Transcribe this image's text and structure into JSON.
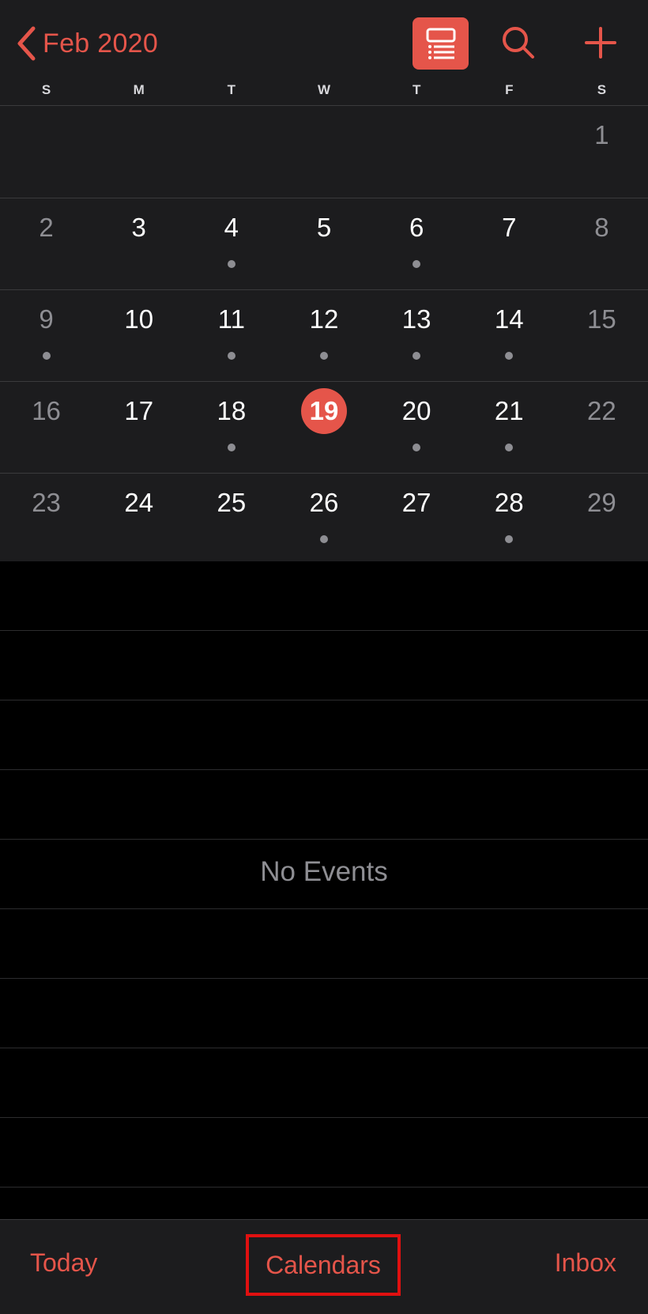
{
  "header": {
    "back_label": "Feb 2020",
    "accent_color": "#e5554a",
    "icons": {
      "back": "chevron-left-icon",
      "list_view": "list-view-icon",
      "search": "search-icon",
      "add": "plus-icon"
    }
  },
  "weekdays": [
    "S",
    "M",
    "T",
    "W",
    "T",
    "F",
    "S"
  ],
  "month": {
    "today": "19",
    "weeks": [
      [
        {
          "day": ""
        },
        {
          "day": ""
        },
        {
          "day": ""
        },
        {
          "day": ""
        },
        {
          "day": ""
        },
        {
          "day": ""
        },
        {
          "day": "1",
          "weekend": true
        }
      ],
      [
        {
          "day": "2",
          "weekend": true
        },
        {
          "day": "3"
        },
        {
          "day": "4",
          "event": true
        },
        {
          "day": "5"
        },
        {
          "day": "6",
          "event": true
        },
        {
          "day": "7"
        },
        {
          "day": "8",
          "weekend": true
        }
      ],
      [
        {
          "day": "9",
          "weekend": true,
          "event": true
        },
        {
          "day": "10"
        },
        {
          "day": "11",
          "event": true
        },
        {
          "day": "12",
          "event": true
        },
        {
          "day": "13",
          "event": true
        },
        {
          "day": "14",
          "event": true
        },
        {
          "day": "15",
          "weekend": true
        }
      ],
      [
        {
          "day": "16",
          "weekend": true
        },
        {
          "day": "17"
        },
        {
          "day": "18",
          "event": true
        },
        {
          "day": "19",
          "today": true
        },
        {
          "day": "20",
          "event": true
        },
        {
          "day": "21",
          "event": true
        },
        {
          "day": "22",
          "weekend": true
        }
      ],
      [
        {
          "day": "23",
          "weekend": true
        },
        {
          "day": "24"
        },
        {
          "day": "25"
        },
        {
          "day": "26",
          "event": true
        },
        {
          "day": "27"
        },
        {
          "day": "28",
          "event": true
        },
        {
          "day": "29",
          "weekend": true
        }
      ]
    ]
  },
  "events": {
    "empty_text": "No Events"
  },
  "tabbar": {
    "today_label": "Today",
    "calendars_label": "Calendars",
    "inbox_label": "Inbox",
    "highlight_color": "#e01010"
  }
}
